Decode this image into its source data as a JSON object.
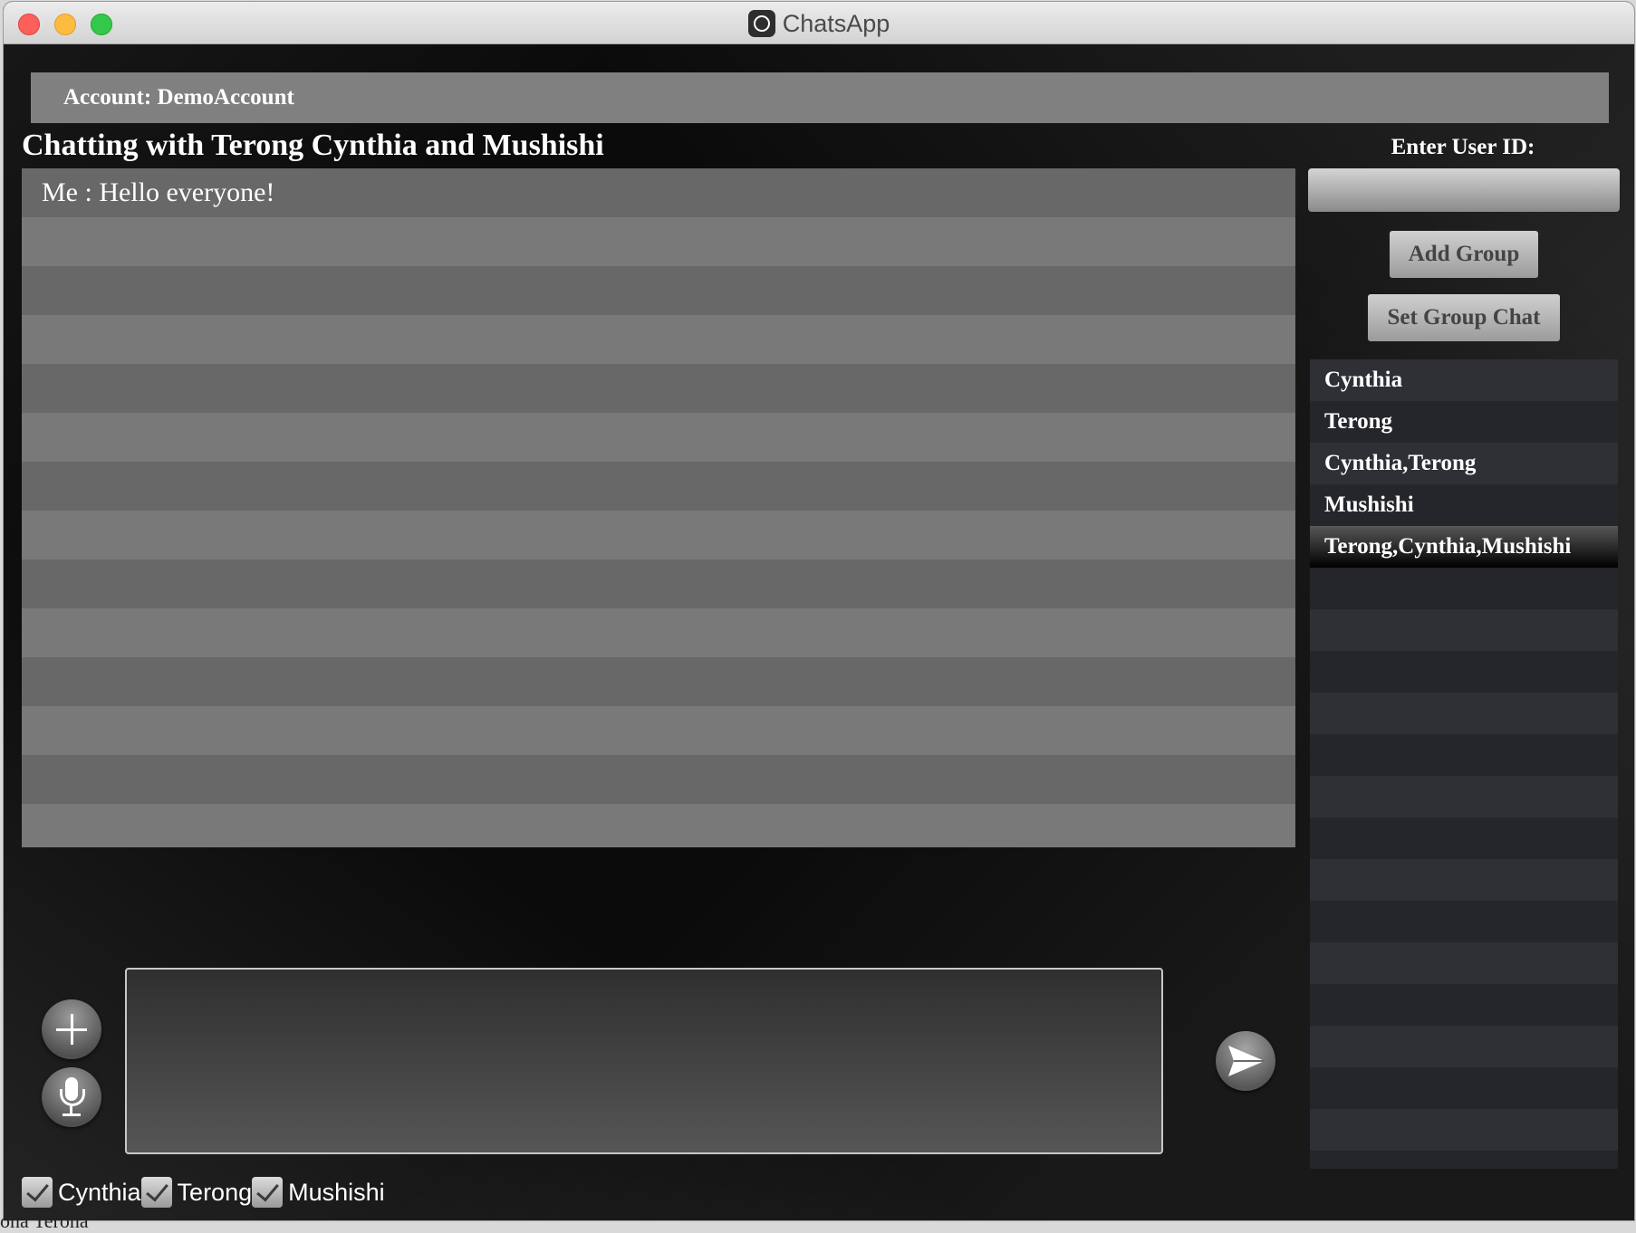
{
  "window": {
    "title": "ChatsApp"
  },
  "account": {
    "label": "Account: DemoAccount"
  },
  "chat": {
    "title": "Chatting with Terong Cynthia and Mushishi",
    "messages": [
      {
        "text": "Me : Hello everyone!"
      }
    ]
  },
  "compose": {
    "value": ""
  },
  "recipients": [
    {
      "name": "Cynthia",
      "checked": true
    },
    {
      "name": "Terong",
      "checked": true
    },
    {
      "name": "Mushishi",
      "checked": true
    }
  ],
  "sidebar": {
    "user_id_label": "Enter User ID:",
    "user_id_value": "",
    "add_group_label": "Add Group",
    "set_group_chat_label": "Set Group Chat",
    "groups": [
      {
        "label": "Cynthia"
      },
      {
        "label": "Terong"
      },
      {
        "label": "Cynthia,Terong"
      },
      {
        "label": "Mushishi"
      },
      {
        "label": "Terong,Cynthia,Mushishi",
        "selected": true
      }
    ]
  },
  "background_edge_text": "ona Terona"
}
